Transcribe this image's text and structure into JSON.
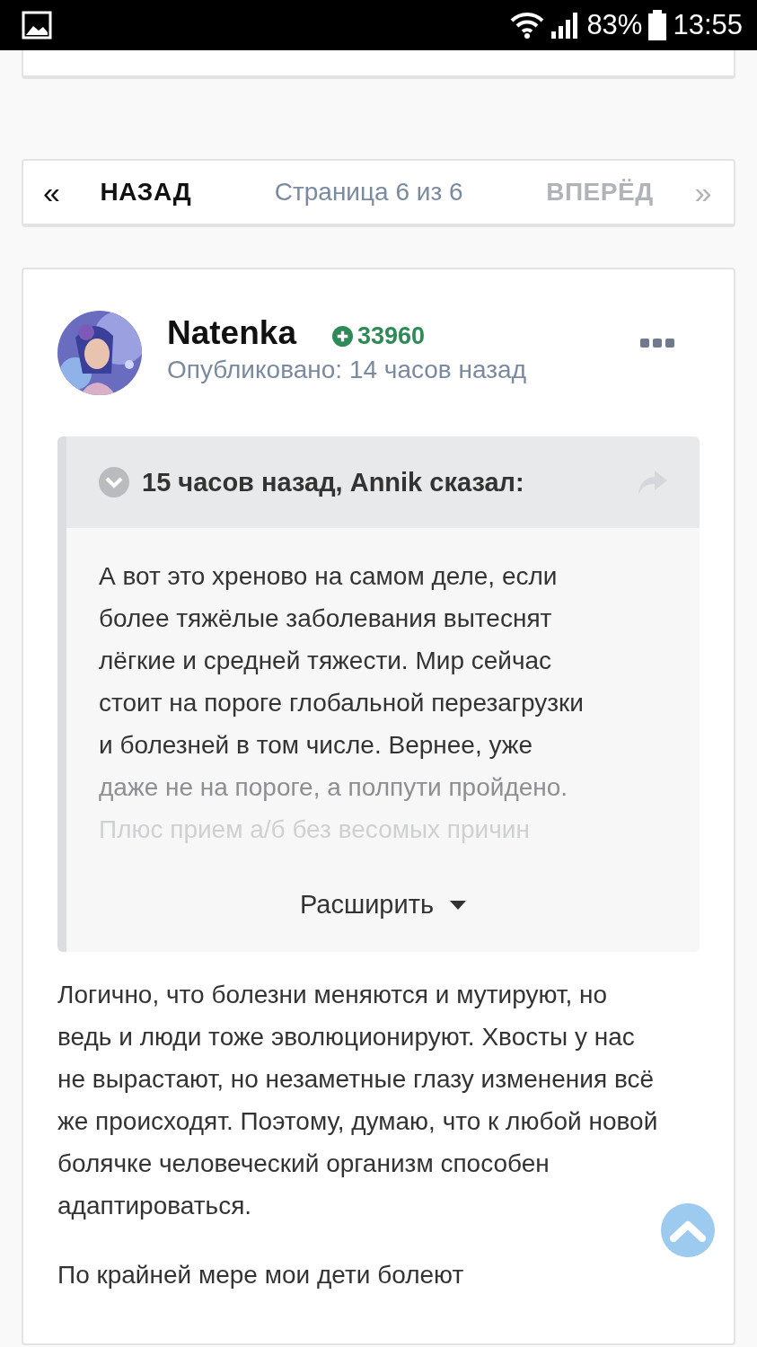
{
  "status_bar": {
    "battery": "83%",
    "time": "13:55"
  },
  "pagination": {
    "prev": "НАЗАД",
    "page_info": "Страница 6 из 6",
    "next": "ВПЕРЁД",
    "next_disabled": true,
    "prev_symbol": "«",
    "next_symbol": "»"
  },
  "post": {
    "author": "Natenka",
    "reputation": "33960",
    "published": "Опубликовано: 14 часов назад",
    "quote": {
      "header": "15 часов назад, Annik сказал:",
      "expand": "Расширить",
      "lines": [
        {
          "text": "А вот это хреново на самом деле, если",
          "kind": "full"
        },
        {
          "text": "более тяжёлые заболевания вытеснят",
          "kind": "full"
        },
        {
          "text": "лёгкие и средней тяжести. Мир сейчас",
          "kind": "full"
        },
        {
          "text": "стоит на пороге глобальной перезагрузки",
          "kind": "full"
        },
        {
          "text": "и болезней в том числе. Вернее, уже",
          "kind": "full"
        },
        {
          "text": "даже не на пороге, а полпути пройдено.",
          "kind": "faded"
        },
        {
          "text": "Плюс прием а/б без весомых причин",
          "kind": "faint"
        }
      ]
    },
    "paragraphs": [
      "Логично, что болезни меняются и мутируют, но ведь и люди тоже эволюционируют. Хвосты у нас не вырастают, но незаметные глазу изменения всё же происходят. Поэтому, думаю, что к любой новой болячке человеческий организм способен адаптироваться.",
      "По крайней мере мои дети болеют"
    ]
  }
}
